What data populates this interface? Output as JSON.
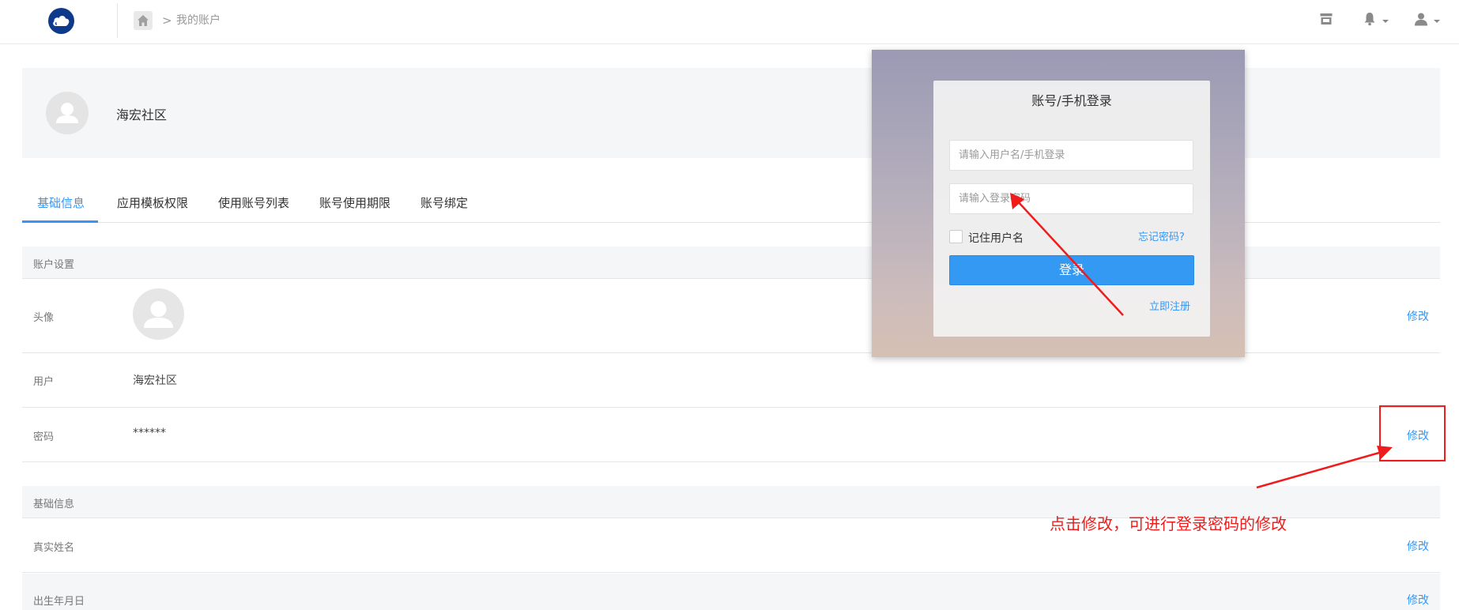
{
  "header": {
    "breadcrumb_separator": ">",
    "breadcrumb_current": "我的账户",
    "icons": [
      "cloud-logo-icon",
      "home-icon",
      "store-icon",
      "bell-icon",
      "user-icon"
    ]
  },
  "profile": {
    "name": "海宏社区"
  },
  "tabs": [
    {
      "label": "基础信息",
      "active": true
    },
    {
      "label": "应用模板权限",
      "active": false
    },
    {
      "label": "使用账号列表",
      "active": false
    },
    {
      "label": "账号使用期限",
      "active": false
    },
    {
      "label": "账号绑定",
      "active": false
    }
  ],
  "account_settings": {
    "title": "账户设置",
    "rows": {
      "avatar": {
        "label": "头像",
        "action": "修改"
      },
      "user": {
        "label": "用户",
        "value": "海宏社区"
      },
      "password": {
        "label": "密码",
        "value": "******",
        "action": "修改"
      }
    }
  },
  "basic_info": {
    "title": "基础信息",
    "rows": {
      "real_name": {
        "label": "真实姓名",
        "action": "修改"
      },
      "birthday": {
        "label": "出生年月日",
        "action": "修改"
      }
    }
  },
  "login_dialog": {
    "title": "账号/手机登录",
    "username_placeholder": "请输入用户名/手机登录",
    "password_placeholder": "请输入登录密码",
    "remember_label": "记住用户名",
    "remember_checked": false,
    "forgot_label": "忘记密码?",
    "login_button": "登录",
    "register_label": "立即注册"
  },
  "annotation": {
    "text": "点击修改，可进行登录密码的修改",
    "color": "#f01c1c"
  },
  "colors": {
    "accent": "#3596f5",
    "section_bg": "#f5f6f8",
    "annotation": "#f01c1c"
  }
}
